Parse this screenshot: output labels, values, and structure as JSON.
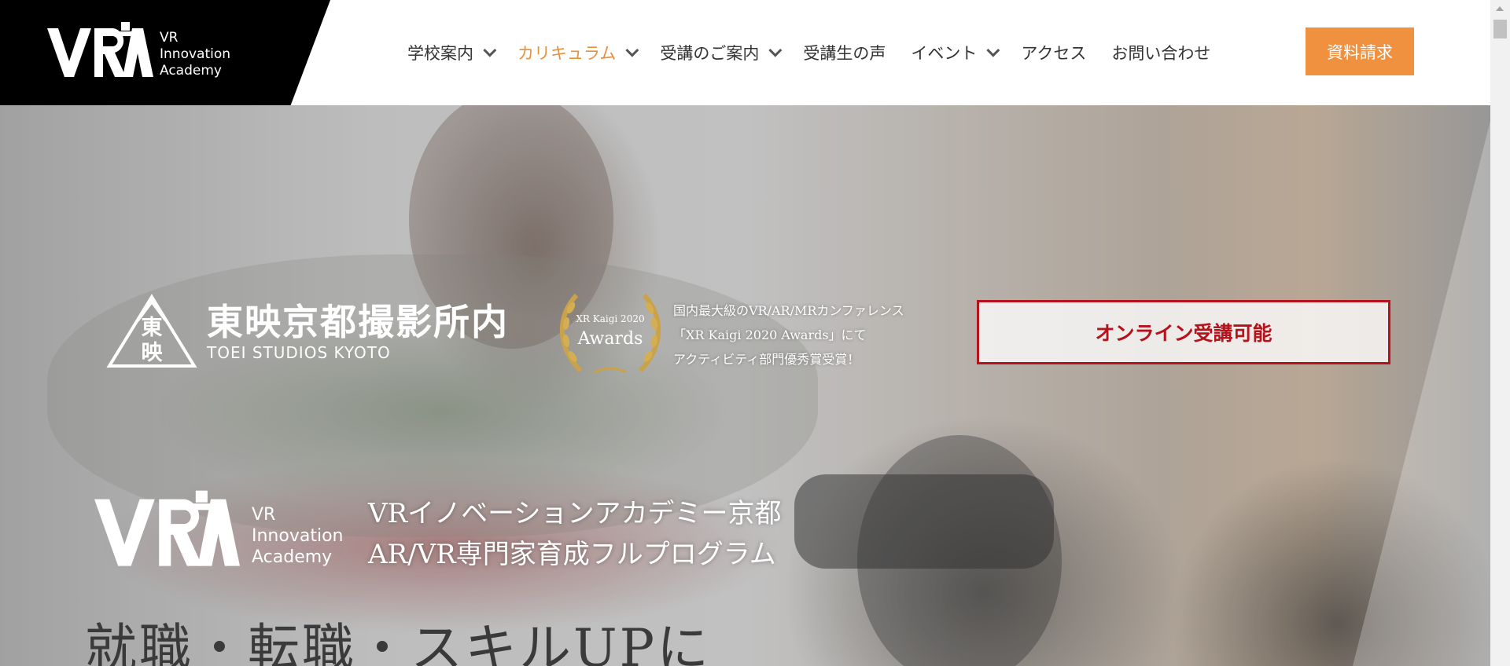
{
  "header": {
    "logo_text": [
      "VR",
      "Innovation",
      "Academy"
    ],
    "nav": [
      {
        "label": "学校案内",
        "has_dropdown": true,
        "active": false
      },
      {
        "label": "カリキュラム",
        "has_dropdown": true,
        "active": true
      },
      {
        "label": "受講のご案内",
        "has_dropdown": true,
        "active": false
      },
      {
        "label": "受講生の声",
        "has_dropdown": false,
        "active": false
      },
      {
        "label": "イベント",
        "has_dropdown": true,
        "active": false
      },
      {
        "label": "アクセス",
        "has_dropdown": false,
        "active": false
      },
      {
        "label": "お問い合わせ",
        "has_dropdown": false,
        "active": false
      }
    ],
    "cta_label": "資料請求"
  },
  "hero": {
    "toei": {
      "emblem_char_1": "東",
      "emblem_char_2": "映",
      "name": "東映京都撮影所内",
      "name_en": "TOEI STUDIOS KYOTO"
    },
    "award": {
      "badge_line1": "XR Kaigi 2020",
      "badge_line2": "Awards",
      "lines": [
        "国内最大級のVR/AR/MRカンファレンス",
        "「XR Kaigi 2020 Awards」にて",
        "アクティビティ部門優秀賞受賞！"
      ]
    },
    "online_badge": "オンライン受講可能",
    "logo_text": [
      "VR",
      "Innovation",
      "Academy"
    ],
    "tagline": [
      "VRイノベーションアカデミー京都",
      "AR/VR専門家育成フルプログラム"
    ],
    "headline": "就職・転職・スキルUPに"
  },
  "colors": {
    "accent": "#f0913f",
    "active_nav": "#e8913a",
    "badge_red": "#b5121b"
  }
}
